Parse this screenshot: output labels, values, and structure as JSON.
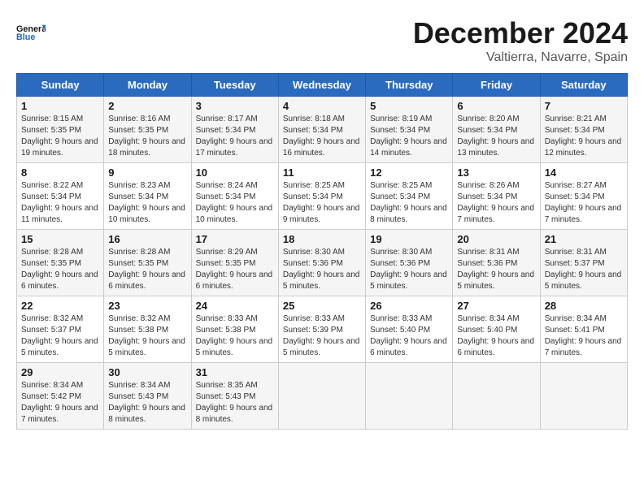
{
  "header": {
    "logo_line1": "General",
    "logo_line2": "Blue",
    "month": "December 2024",
    "location": "Valtierra, Navarre, Spain"
  },
  "weekdays": [
    "Sunday",
    "Monday",
    "Tuesday",
    "Wednesday",
    "Thursday",
    "Friday",
    "Saturday"
  ],
  "weeks": [
    [
      {
        "day": "1",
        "sunrise": "8:15 AM",
        "sunset": "5:35 PM",
        "daylight": "9 hours and 19 minutes."
      },
      {
        "day": "2",
        "sunrise": "8:16 AM",
        "sunset": "5:35 PM",
        "daylight": "9 hours and 18 minutes."
      },
      {
        "day": "3",
        "sunrise": "8:17 AM",
        "sunset": "5:34 PM",
        "daylight": "9 hours and 17 minutes."
      },
      {
        "day": "4",
        "sunrise": "8:18 AM",
        "sunset": "5:34 PM",
        "daylight": "9 hours and 16 minutes."
      },
      {
        "day": "5",
        "sunrise": "8:19 AM",
        "sunset": "5:34 PM",
        "daylight": "9 hours and 14 minutes."
      },
      {
        "day": "6",
        "sunrise": "8:20 AM",
        "sunset": "5:34 PM",
        "daylight": "9 hours and 13 minutes."
      },
      {
        "day": "7",
        "sunrise": "8:21 AM",
        "sunset": "5:34 PM",
        "daylight": "9 hours and 12 minutes."
      }
    ],
    [
      {
        "day": "8",
        "sunrise": "8:22 AM",
        "sunset": "5:34 PM",
        "daylight": "9 hours and 11 minutes."
      },
      {
        "day": "9",
        "sunrise": "8:23 AM",
        "sunset": "5:34 PM",
        "daylight": "9 hours and 10 minutes."
      },
      {
        "day": "10",
        "sunrise": "8:24 AM",
        "sunset": "5:34 PM",
        "daylight": "9 hours and 10 minutes."
      },
      {
        "day": "11",
        "sunrise": "8:25 AM",
        "sunset": "5:34 PM",
        "daylight": "9 hours and 9 minutes."
      },
      {
        "day": "12",
        "sunrise": "8:25 AM",
        "sunset": "5:34 PM",
        "daylight": "9 hours and 8 minutes."
      },
      {
        "day": "13",
        "sunrise": "8:26 AM",
        "sunset": "5:34 PM",
        "daylight": "9 hours and 7 minutes."
      },
      {
        "day": "14",
        "sunrise": "8:27 AM",
        "sunset": "5:34 PM",
        "daylight": "9 hours and 7 minutes."
      }
    ],
    [
      {
        "day": "15",
        "sunrise": "8:28 AM",
        "sunset": "5:35 PM",
        "daylight": "9 hours and 6 minutes."
      },
      {
        "day": "16",
        "sunrise": "8:28 AM",
        "sunset": "5:35 PM",
        "daylight": "9 hours and 6 minutes."
      },
      {
        "day": "17",
        "sunrise": "8:29 AM",
        "sunset": "5:35 PM",
        "daylight": "9 hours and 6 minutes."
      },
      {
        "day": "18",
        "sunrise": "8:30 AM",
        "sunset": "5:36 PM",
        "daylight": "9 hours and 5 minutes."
      },
      {
        "day": "19",
        "sunrise": "8:30 AM",
        "sunset": "5:36 PM",
        "daylight": "9 hours and 5 minutes."
      },
      {
        "day": "20",
        "sunrise": "8:31 AM",
        "sunset": "5:36 PM",
        "daylight": "9 hours and 5 minutes."
      },
      {
        "day": "21",
        "sunrise": "8:31 AM",
        "sunset": "5:37 PM",
        "daylight": "9 hours and 5 minutes."
      }
    ],
    [
      {
        "day": "22",
        "sunrise": "8:32 AM",
        "sunset": "5:37 PM",
        "daylight": "9 hours and 5 minutes."
      },
      {
        "day": "23",
        "sunrise": "8:32 AM",
        "sunset": "5:38 PM",
        "daylight": "9 hours and 5 minutes."
      },
      {
        "day": "24",
        "sunrise": "8:33 AM",
        "sunset": "5:38 PM",
        "daylight": "9 hours and 5 minutes."
      },
      {
        "day": "25",
        "sunrise": "8:33 AM",
        "sunset": "5:39 PM",
        "daylight": "9 hours and 5 minutes."
      },
      {
        "day": "26",
        "sunrise": "8:33 AM",
        "sunset": "5:40 PM",
        "daylight": "9 hours and 6 minutes."
      },
      {
        "day": "27",
        "sunrise": "8:34 AM",
        "sunset": "5:40 PM",
        "daylight": "9 hours and 6 minutes."
      },
      {
        "day": "28",
        "sunrise": "8:34 AM",
        "sunset": "5:41 PM",
        "daylight": "9 hours and 7 minutes."
      }
    ],
    [
      {
        "day": "29",
        "sunrise": "8:34 AM",
        "sunset": "5:42 PM",
        "daylight": "9 hours and 7 minutes."
      },
      {
        "day": "30",
        "sunrise": "8:34 AM",
        "sunset": "5:43 PM",
        "daylight": "9 hours and 8 minutes."
      },
      {
        "day": "31",
        "sunrise": "8:35 AM",
        "sunset": "5:43 PM",
        "daylight": "9 hours and 8 minutes."
      },
      null,
      null,
      null,
      null
    ]
  ]
}
